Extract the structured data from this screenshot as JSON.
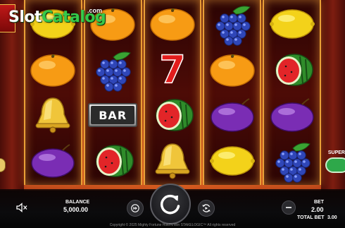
{
  "watermark": {
    "brand_main": "Slot",
    "brand_accent": "Catalog",
    "brand_suffix": ".com"
  },
  "reels": [
    [
      "lemon",
      "orange",
      "bell",
      "plum"
    ],
    [
      "orange",
      "grapes",
      "bar",
      "watermelon"
    ],
    [
      "orange",
      "seven",
      "watermelon",
      "bell"
    ],
    [
      "grapes",
      "orange",
      "plum",
      "lemon"
    ],
    [
      "lemon",
      "watermelon",
      "plum",
      "grapes"
    ]
  ],
  "symbols": {
    "bar_text": "BAR",
    "seven_text": "7"
  },
  "super": {
    "label": "SUPER"
  },
  "controls": {
    "balance_label": "BALANCE",
    "balance_value": "5,000.00",
    "bet_label": "BET",
    "bet_value": "2.00",
    "total_bet_label": "TOTAL BET",
    "total_bet_value": "3.00"
  },
  "icons": {
    "sound": "sound-muted-icon",
    "turbo": "turbo-icon",
    "spin": "spin-icon",
    "autoplay": "autoplay-icon",
    "bet_minus": "minus-icon"
  },
  "footer": "Copyright © 2025 Mighty Fortune Hold'N'Win STAKELOGIC™ All rights reserved"
}
